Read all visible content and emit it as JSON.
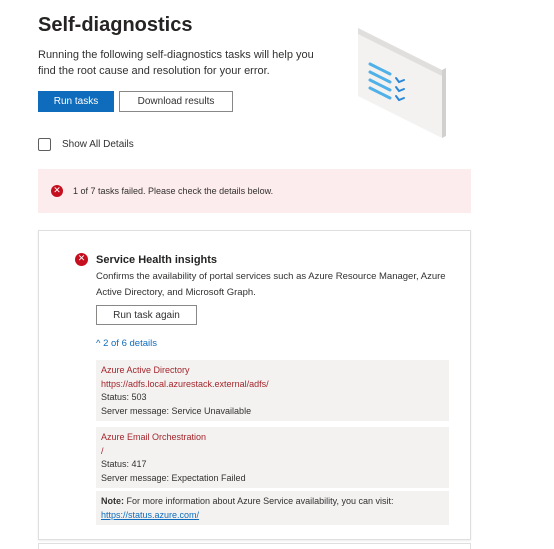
{
  "page": {
    "title": "Self-diagnostics",
    "description": "Running the following self-diagnostics tasks will help you find the root cause and resolution for your error."
  },
  "actions": {
    "run_tasks": "Run tasks",
    "download_results": "Download results"
  },
  "options": {
    "show_all_details": "Show All Details",
    "show_all_checked": false
  },
  "alert": {
    "icon": "error-icon",
    "text": "1 of 7 tasks failed. Please check the details below."
  },
  "task": {
    "icon": "error-icon",
    "title": "Service Health insights",
    "description": "Confirms the availability of portal services such as Azure Resource Manager, Azure Active Directory, and Microsoft Graph.",
    "run_again": "Run task again",
    "details_toggle": "^ 2 of 6 details",
    "details": [
      {
        "name": "Azure Active Directory",
        "url": "https://adfs.local.azurestack.external/adfs/",
        "status": "Status: 503",
        "message": "Server message: Service Unavailable"
      },
      {
        "name": "Azure Email Orchestration",
        "url": "/",
        "status": "Status: 417",
        "message": "Server message: Expectation Failed"
      }
    ],
    "note": {
      "label": "Note:",
      "text": "For more information about Azure Service availability, you can visit:",
      "link": "https://status.azure.com/"
    }
  },
  "colors": {
    "primary": "#0f6cbd",
    "error": "#c50f1f",
    "error_text": "#a4262c",
    "alert_bg": "#fdeced",
    "detail_bg": "#f3f2f1"
  }
}
